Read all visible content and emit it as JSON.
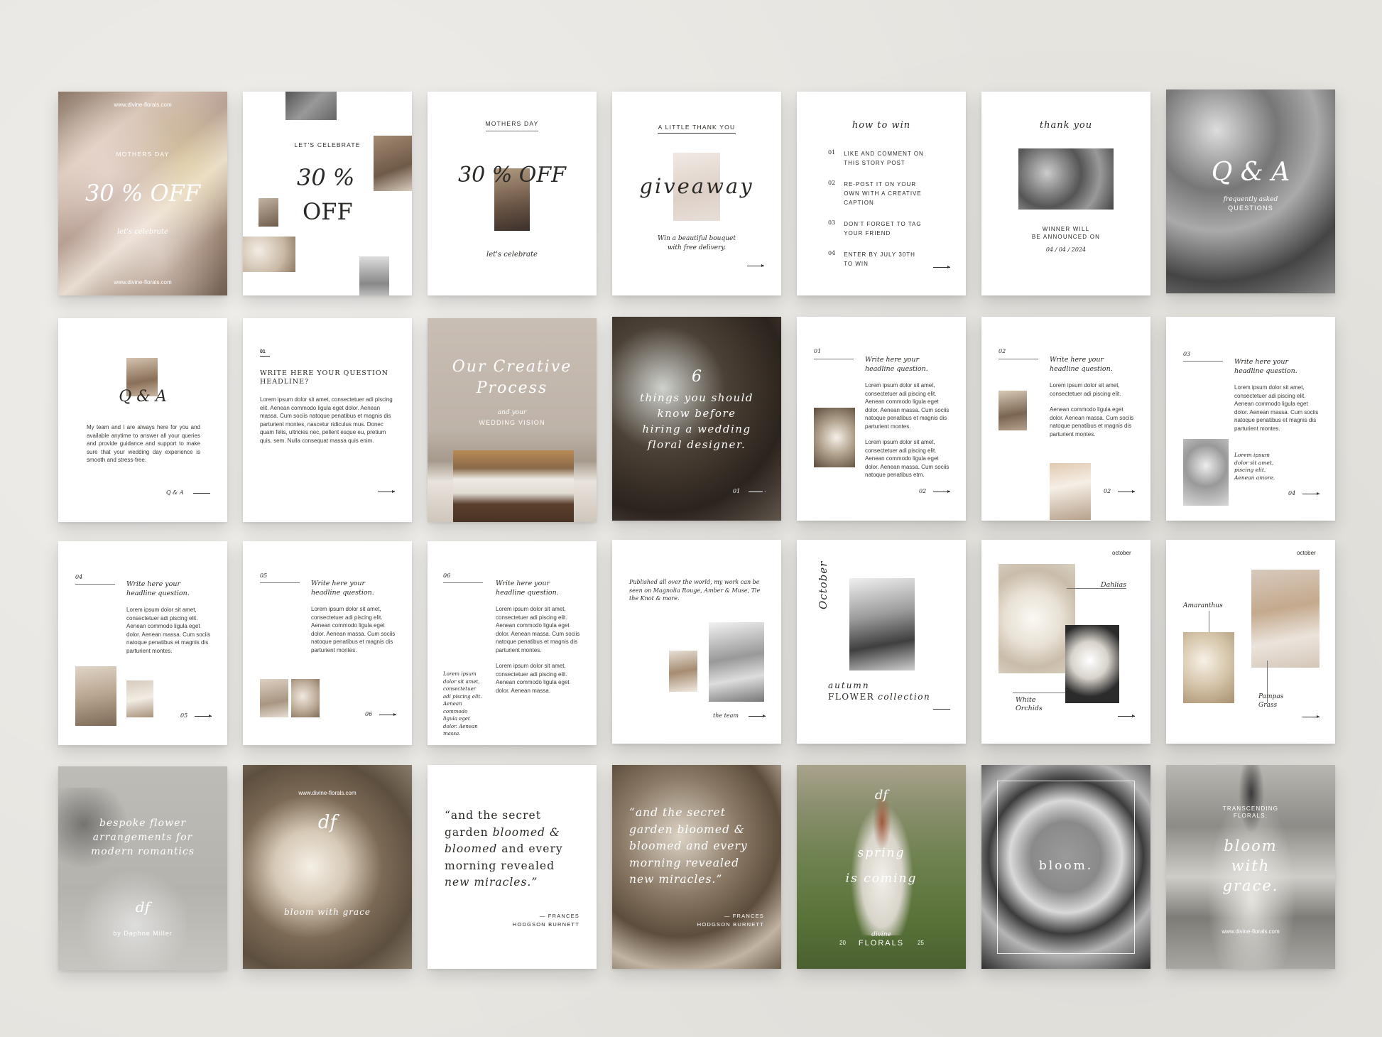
{
  "colors": {
    "background": "#e6e4df",
    "card": "#ffffff",
    "ink": "#2b2925"
  },
  "row1": {
    "c1": {
      "url_top": "www.divine-florals.com",
      "eyebrow": "MOTHERS DAY",
      "headline": "30 % OFF",
      "sub": "let's celebrate",
      "url_bottom": "www.divine-florals.com"
    },
    "c2": {
      "eyebrow": "LET'S CELEBRATE",
      "headline_1": "30 %",
      "headline_2": "OFF"
    },
    "c3": {
      "eyebrow": "MOTHERS DAY",
      "headline": "30 % OFF",
      "sub": "let's celebrate"
    },
    "c4": {
      "eyebrow": "A LITTLE THANK YOU",
      "headline": "giveaway",
      "sub_1": "Win a beautiful bouquet",
      "sub_2": "with free delivery."
    },
    "c5": {
      "title": "how to win",
      "steps": [
        {
          "num": "01",
          "l1": "LIKE AND COMMENT ON",
          "l2": "THIS STORY POST",
          "l3": ""
        },
        {
          "num": "02",
          "l1": "RE-POST IT ON YOUR",
          "l2": "OWN WITH A CREATIVE",
          "l3": "CAPTION"
        },
        {
          "num": "03",
          "l1": "DON'T FORGET TO TAG",
          "l2": "YOUR FRIEND",
          "l3": ""
        },
        {
          "num": "04",
          "l1": "ENTER BY JULY 30TH",
          "l2": "TO WIN",
          "l3": ""
        }
      ]
    },
    "c6": {
      "title": "thank you",
      "l1": "WINNER WILL",
      "l2": "BE ANNOUNCED ON",
      "date": "04 / 04 / 2024"
    },
    "c7": {
      "headline": "Q & A",
      "sub": "frequently asked",
      "sub2": "QUESTIONS"
    }
  },
  "row2": {
    "c1": {
      "headline": "Q & A",
      "body": "My team and I are always here for you and available anytime to answer all your queries and provide guidance and support to make sure that your wedding day experience is smooth and stress-free.",
      "footer": "Q & A"
    },
    "c2": {
      "num": "01",
      "q1": "WRITE HERE YOUR QUESTION",
      "q2": "HEADLINE?",
      "body": "Lorem ipsum dolor sit amet, consectetuer adi piscing elit. Aenean commodo ligula eget dolor. Aenean massa. Cum sociis natoque penatibus et magnis dis parturient montes, nascetur ridiculus mus. Donec quam felis, ultricies nec, pellent esque eu, pretium quis, sem. Nulla consequat massa quis enim."
    },
    "c3": {
      "h1": "Our Creative",
      "h2": "Process",
      "sub": "and your",
      "sub2": "WEDDING VISION"
    },
    "c4": {
      "num": "6",
      "l1": "things you should",
      "l2": "know before",
      "l3": "hiring a wedding",
      "l4": "floral designer.",
      "page": "01"
    },
    "c5": {
      "num": "01",
      "q1": "Write here your",
      "q2": "headline question.",
      "p1": "Lorem ipsum dolor sit amet, consectetuer adi piscing elit. Aenean commodo ligula eget dolor. Aenean massa. Cum sociis natoque penatibus et magnis dis parturient montes.",
      "p2": "Lorem ipsum dolor sit amet, consectetuer adi piscing elit. Aenean commodo ligula eget dolor. Aenean massa. Cum sociis natoque penatibus etm.",
      "page": "02"
    },
    "c6": {
      "num": "02",
      "q1": "Write here your",
      "q2": "headline question.",
      "p1": "Lorem ipsum dolor sit amet, consectetuer adi piscing elit.",
      "p2": "Aenean commodo ligula eget dolor. Aenean massa. Cum sociis natoque penatibus et magnis dis parturient montes.",
      "page": "02"
    },
    "c7": {
      "num": "03",
      "q1": "Write here your",
      "q2": "headline question.",
      "p1": "Lorem ipsum dolor sit amet, consectetuer adi piscing elit. Aenean commodo ligula eget dolor. Aenean massa. Cum sociis natoque penatibus et magnis dis parturient montes.",
      "quote": "Lorem ipsum dolor sit amet, piscing elit. Aenean amore.",
      "page": "04"
    }
  },
  "row3": {
    "c1": {
      "num": "04",
      "q1": "Write here your",
      "q2": "headline question.",
      "p1": "Lorem ipsum dolor sit amet, consectetuer adi piscing elit. Aenean commodo ligula eget dolor. Aenean massa. Cum sociis natoque penatibus et magnis dis parturient montes.",
      "page": "05"
    },
    "c2": {
      "num": "05",
      "q1": "Write here your",
      "q2": "headline question.",
      "p1": "Lorem ipsum dolor sit amet, consectetuer adi piscing elit. Aenean commodo ligula eget dolor. Aenean massa. Cum sociis natoque penatibus et magnis dis parturient montes.",
      "page": "06"
    },
    "c3": {
      "num": "06",
      "q1": "Write here your",
      "q2": "headline question.",
      "p1": "Lorem ipsum dolor sit amet, consectetuer adi piscing elit. Aenean commodo ligula eget dolor. Aenean massa. Cum sociis natoque penatibus et magnis dis parturient montes.",
      "p2": "Lorem ipsum dolor sit amet, consectetuer adi piscing elit. Aenean commodo ligula eget dolor. Aenean massa.",
      "quote": "Lorem ipsum dolor sit amet, consectetuer adi piscing elit. Aenean commodo ligula eget dolor. Aenean massa."
    },
    "c4": {
      "intro": "Published all over the world, my work can be seen on Magnolia Rouge, Amber & Muse, Tie the Knot & more.",
      "footer": "the team"
    },
    "c5": {
      "vertical": "October",
      "l1": "autumn",
      "l2a": "FLOWER",
      "l2b": "collection"
    },
    "c6": {
      "month": "october",
      "label1": "Dahlias",
      "label2a": "White",
      "label2b": "Orchids"
    },
    "c7": {
      "month": "october",
      "label1": "Amaranthus",
      "label2a": "Pampas",
      "label2b": "Grass"
    }
  },
  "row4": {
    "c1": {
      "l1": "bespoke flower",
      "l2": "arrangements for",
      "l3": "modern romantics",
      "mono": "df",
      "by": "by Daphne Miller"
    },
    "c2": {
      "url": "www.divine-florals.com",
      "mono": "df",
      "tag": "bloom with grace"
    },
    "c3": {
      "q1": "“and the secret",
      "q2a": "garden",
      "q2b": "bloomed &",
      "q3a": "bloomed",
      "q3b": "and every",
      "q4": "morning revealed",
      "q5": "new miracles.”",
      "a1": "— FRANCES",
      "a2": "HODGSON BURNETT"
    },
    "c4": {
      "q1": "“and the secret",
      "q2": "garden bloomed &",
      "q3": "bloomed and every",
      "q4": "morning revealed",
      "q5": "new miracles.”",
      "a1": "— FRANCES",
      "a2": "HODGSON BURNETT"
    },
    "c5": {
      "mono": "df",
      "l1": "spring",
      "l2": "is coming",
      "brand1": "divine",
      "brand2": "FLORALS",
      "left": "20",
      "right": "25"
    },
    "c6": {
      "word": "bloom."
    },
    "c7": {
      "eyebrow1": "TRANSCENDING",
      "eyebrow2": "FLORALS.",
      "l1": "bloom",
      "l2": "with",
      "l3": "grace.",
      "url": "www.divine-florals.com"
    }
  }
}
